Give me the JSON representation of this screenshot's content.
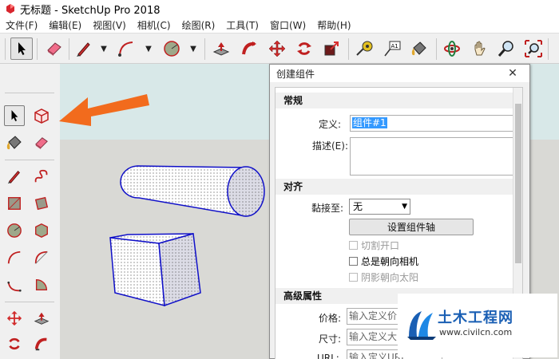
{
  "window": {
    "title": "无标题 - SketchUp Pro 2018"
  },
  "menubar": {
    "items": [
      "文件(F)",
      "编辑(E)",
      "视图(V)",
      "相机(C)",
      "绘图(R)",
      "工具(T)",
      "窗口(W)",
      "帮助(H)"
    ]
  },
  "dialog": {
    "title": "创建组件",
    "close_glyph": "✕",
    "sections": {
      "general": "常规",
      "alignment": "对齐",
      "advanced": "高级属性"
    },
    "definition": {
      "label": "定义:",
      "value": "组件#1"
    },
    "description": {
      "label": "描述(E):",
      "value": ""
    },
    "glue_to": {
      "label": "黏接至:",
      "value": "无"
    },
    "set_axes_button": "设置组件轴",
    "checkboxes": [
      {
        "label": "切割开口",
        "checked": false,
        "enabled": false
      },
      {
        "label": "总是朝向相机",
        "checked": false,
        "enabled": true
      },
      {
        "label": "阴影朝向太阳",
        "checked": false,
        "enabled": false
      }
    ],
    "price": {
      "label": "价格:",
      "placeholder": "输入定义价"
    },
    "size": {
      "label": "尺寸:",
      "placeholder": "输入定义大"
    },
    "url": {
      "label": "URL:",
      "placeholder": "输入定义URL"
    }
  },
  "watermark": {
    "title": "土木工程网",
    "url": "www.civilcn.com"
  },
  "colors": {
    "accent_arrow": "#f26b1d",
    "selection": "#3399ff",
    "watermark_blue": "#1a5fb4"
  }
}
